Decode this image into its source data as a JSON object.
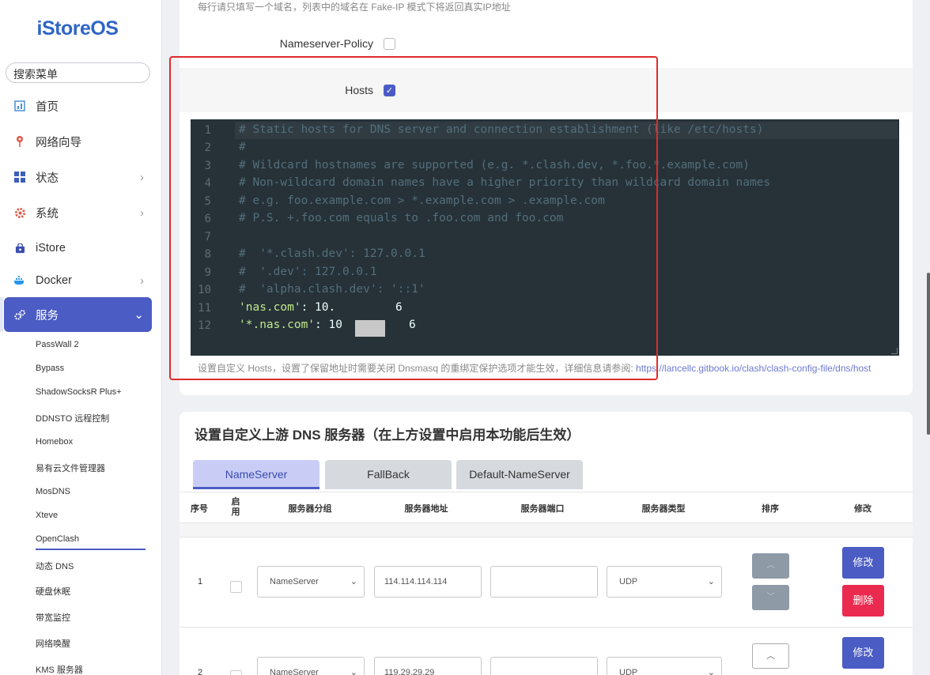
{
  "sidebar": {
    "logo": "iStoreOS",
    "search_placeholder": "搜索菜单",
    "items": [
      {
        "label": "首页"
      },
      {
        "label": "网络向导"
      },
      {
        "label": "状态"
      },
      {
        "label": "系统"
      },
      {
        "label": "iStore"
      },
      {
        "label": "Docker"
      },
      {
        "label": "服务"
      }
    ],
    "sub_items": [
      {
        "label": "PassWall 2"
      },
      {
        "label": "Bypass"
      },
      {
        "label": "ShadowSocksR Plus+"
      },
      {
        "label": "DDNSTO 远程控制"
      },
      {
        "label": "Homebox"
      },
      {
        "label": "易有云文件管理器"
      },
      {
        "label": "MosDNS"
      },
      {
        "label": "Xteve"
      },
      {
        "label": "OpenClash"
      },
      {
        "label": "动态 DNS"
      },
      {
        "label": "硬盘休眠"
      },
      {
        "label": "带宽监控"
      },
      {
        "label": "网络唤醒"
      },
      {
        "label": "KMS 服务器"
      }
    ]
  },
  "settings": {
    "fakeip_desc": "每行请只填写一个域名，列表中的域名在 Fake-IP 模式下将返回真实IP地址",
    "nameserver_policy_label": "Nameserver-Policy",
    "nameserver_policy_checked": false,
    "hosts_label": "Hosts",
    "hosts_checked": true,
    "hosts_lines": [
      {
        "n": "1",
        "text": "# Static hosts for DNS server and connection establishment (like /etc/hosts)"
      },
      {
        "n": "2",
        "text": "#"
      },
      {
        "n": "3",
        "text": "# Wildcard hostnames are supported (e.g. *.clash.dev, *.foo.*.example.com)"
      },
      {
        "n": "4",
        "text": "# Non-wildcard domain names have a higher priority than wildcard domain names"
      },
      {
        "n": "5",
        "text": "# e.g. foo.example.com > *.example.com > .example.com"
      },
      {
        "n": "6",
        "text": "# P.S. +.foo.com equals to .foo.com and foo.com"
      },
      {
        "n": "7",
        "text": ""
      },
      {
        "n": "8",
        "text": "#  '*.clash.dev': 127.0.0.1"
      },
      {
        "n": "9",
        "text": "#  '.dev': 127.0.0.1"
      },
      {
        "n": "10",
        "text": "#  'alpha.clash.dev': '::1'"
      },
      {
        "n": "11",
        "key": "'nas.com'",
        "sep": ": ",
        "val_a": "10.",
        "val_b": "6"
      },
      {
        "n": "12",
        "key": "'*.nas.com'",
        "sep": ": ",
        "val_a": "10",
        "val_b": "6"
      }
    ],
    "hosts_help": "设置自定义 Hosts，设置了保留地址时需要关闭 Dnsmasq 的重绑定保护选项才能生效，详细信息请参阅: ",
    "hosts_help_link": "https://lancellc.gitbook.io/clash/clash-config-file/dns/host"
  },
  "dns_servers": {
    "title": "设置自定义上游 DNS 服务器（在上方设置中启用本功能后生效）",
    "tabs": [
      {
        "label": "NameServer",
        "active": true
      },
      {
        "label": "FallBack",
        "active": false
      },
      {
        "label": "Default-NameServer",
        "active": false
      }
    ],
    "columns": [
      "序号",
      "启用",
      "服务器分组",
      "服务器地址",
      "服务器端口",
      "服务器类型",
      "排序",
      "修改"
    ],
    "enable_col": [
      "启",
      "用"
    ],
    "rows": [
      {
        "index": "1",
        "group": "NameServer",
        "address": "114.114.114.114",
        "port": "",
        "type": "UDP",
        "edit": "修改",
        "delete": "删除"
      },
      {
        "index": "2",
        "group": "NameServer",
        "address": "119.29.29.29",
        "port": "",
        "type": "UDP",
        "edit": "修改"
      }
    ],
    "colors": {
      "accent": "#4b5cc4",
      "danger": "#ea2b4f"
    }
  },
  "icons": [
    "dashboard-icon",
    "wizard-icon",
    "status-icon",
    "system-icon",
    "istore-icon",
    "docker-icon",
    "services-icon"
  ]
}
